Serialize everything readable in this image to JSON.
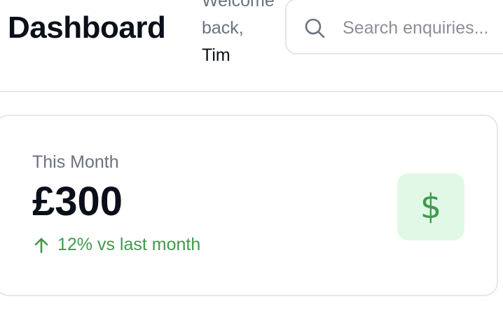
{
  "header": {
    "title": "Dashboard",
    "welcome_text": "Welcome back,",
    "user_name": "Tim"
  },
  "search": {
    "placeholder": "Search enquiries...",
    "icon": "search-icon"
  },
  "card": {
    "label": "This Month",
    "value": "£300",
    "trend_text": "12% vs last month",
    "trend_icon": "arrow-up-icon",
    "badge_icon": "dollar-icon",
    "badge_symbol": "$",
    "accent_color": "#3f9a4b",
    "badge_background": "#e2f8e6"
  }
}
